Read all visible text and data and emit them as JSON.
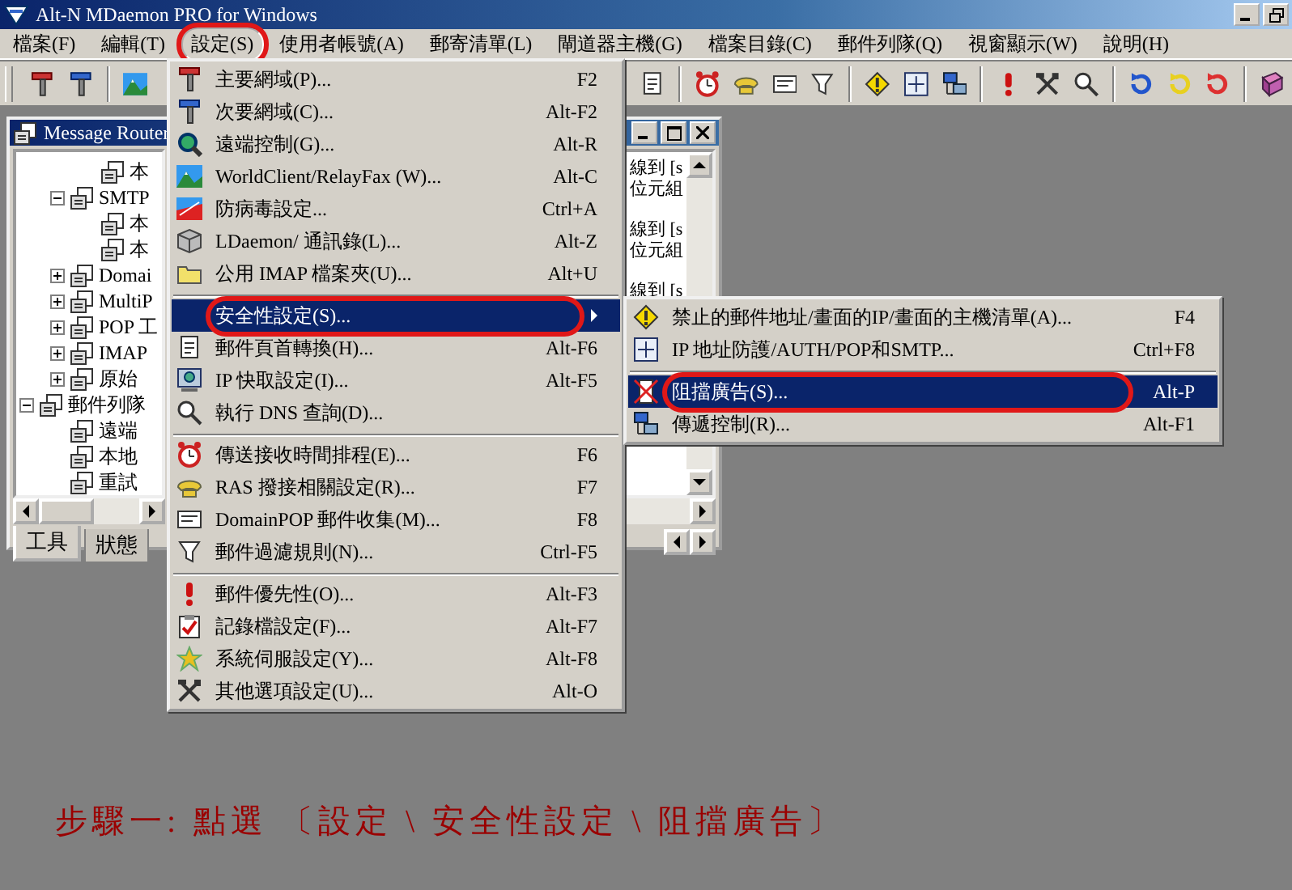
{
  "window": {
    "title": "Alt-N MDaemon PRO for Windows"
  },
  "menubar": {
    "items": [
      {
        "label": "檔案(F)",
        "selected": false,
        "circled": false
      },
      {
        "label": "編輯(T)",
        "selected": false,
        "circled": false
      },
      {
        "label": "設定(S)",
        "selected": true,
        "circled": true
      },
      {
        "label": "使用者帳號(A)",
        "selected": false,
        "circled": false
      },
      {
        "label": "郵寄清單(L)",
        "selected": false,
        "circled": false
      },
      {
        "label": "閘道器主機(G)",
        "selected": false,
        "circled": false
      },
      {
        "label": "檔案目錄(C)",
        "selected": false,
        "circled": false
      },
      {
        "label": "郵件列隊(Q)",
        "selected": false,
        "circled": false
      },
      {
        "label": "視窗顯示(W)",
        "selected": false,
        "circled": false
      },
      {
        "label": "說明(H)",
        "selected": false,
        "circled": false
      }
    ]
  },
  "child_window": {
    "title": "Message Router",
    "tree": [
      {
        "children": [
          {
            "children": [
              {
                "label": "本"
              }
            ]
          },
          {
            "label": "SMTP",
            "expanded": true,
            "children": [
              {
                "label": "本"
              },
              {
                "label": "本"
              }
            ]
          },
          {
            "label": "Domai",
            "expanded": false
          },
          {
            "label": "MultiP",
            "expanded": false
          },
          {
            "label": "POP 工",
            "expanded": false
          },
          {
            "label": "IMAP",
            "expanded": false
          },
          {
            "label": "原始",
            "expanded": false
          }
        ]
      },
      {
        "label": "郵件列隊",
        "expanded": true,
        "children": [
          {
            "label": "遠端"
          },
          {
            "label": "本地"
          },
          {
            "label": "重試"
          }
        ]
      }
    ],
    "log_entries": [
      {
        "text": "線到 [s",
        "detail": "位元組"
      },
      {
        "text": "線到 [s",
        "detail": "位元組"
      },
      {
        "text": "線到 [s"
      }
    ],
    "tabs": [
      {
        "label": "工具",
        "selected": true
      },
      {
        "label": "狀態",
        "selected": false
      }
    ]
  },
  "settings_menu": {
    "groups": [
      {
        "items": [
          {
            "label": "主要網域(P)...",
            "shortcut": "F2",
            "selected": false,
            "circled": false,
            "submenu": false
          },
          {
            "label": "次要網域(C)...",
            "shortcut": "Alt-F2",
            "selected": false,
            "circled": false,
            "submenu": false
          },
          {
            "label": "遠端控制(G)...",
            "shortcut": "Alt-R",
            "selected": false,
            "circled": false,
            "submenu": false
          },
          {
            "label": "WorldClient/RelayFax (W)...",
            "shortcut": "Alt-C",
            "selected": false,
            "circled": false,
            "submenu": false
          },
          {
            "label": "防病毒設定...",
            "shortcut": "Ctrl+A",
            "selected": false,
            "circled": false,
            "submenu": false
          },
          {
            "label": "LDaemon/ 通訊錄(L)...",
            "shortcut": "Alt-Z",
            "selected": false,
            "circled": false,
            "submenu": false
          },
          {
            "label": "公用 IMAP 檔案夾(U)...",
            "shortcut": "Alt+U",
            "selected": false,
            "circled": false,
            "submenu": false
          }
        ]
      },
      {
        "items": [
          {
            "label": "安全性設定(S)...",
            "selected": true,
            "circled": true,
            "submenu": true
          },
          {
            "label": "郵件頁首轉換(H)...",
            "shortcut": "Alt-F6",
            "selected": false,
            "circled": false,
            "submenu": false
          },
          {
            "label": "IP 快取設定(I)...",
            "shortcut": "Alt-F5",
            "selected": false,
            "circled": false,
            "submenu": false
          },
          {
            "label": "執行 DNS 查詢(D)...",
            "selected": false,
            "circled": false,
            "submenu": false
          }
        ]
      },
      {
        "items": [
          {
            "label": "傳送接收時間排程(E)...",
            "shortcut": "F6",
            "selected": false,
            "circled": false,
            "submenu": false
          },
          {
            "label": "RAS 撥接相關設定(R)...",
            "shortcut": "F7",
            "selected": false,
            "circled": false,
            "submenu": false
          },
          {
            "label": "DomainPOP 郵件收集(M)...",
            "shortcut": "F8",
            "selected": false,
            "circled": false,
            "submenu": false
          },
          {
            "label": "郵件過濾規則(N)...",
            "shortcut": "Ctrl-F5",
            "selected": false,
            "circled": false,
            "submenu": false
          }
        ]
      },
      {
        "items": [
          {
            "label": "郵件優先性(O)...",
            "shortcut": "Alt-F3",
            "selected": false,
            "circled": false,
            "submenu": false
          },
          {
            "label": "記錄檔設定(F)...",
            "shortcut": "Alt-F7",
            "selected": false,
            "circled": false,
            "submenu": false
          },
          {
            "label": "系統伺服設定(Y)...",
            "shortcut": "Alt-F8",
            "selected": false,
            "circled": false,
            "submenu": false
          },
          {
            "label": "其他選項設定(U)...",
            "shortcut": "Alt-O",
            "selected": false,
            "circled": false,
            "submenu": false
          }
        ]
      }
    ]
  },
  "security_submenu": {
    "groups": [
      {
        "items": [
          {
            "label": "禁止的郵件地址/畫面的IP/畫面的主機清單(A)...",
            "shortcut": "F4",
            "selected": false,
            "circled": false,
            "submenu": false
          },
          {
            "label": "IP 地址防護/AUTH/POP和SMTP...",
            "shortcut": "Ctrl+F8",
            "selected": false,
            "circled": false,
            "submenu": false
          }
        ]
      },
      {
        "items": [
          {
            "label": "阻擋廣告(S)...",
            "shortcut": "Alt-P",
            "selected": true,
            "circled": true,
            "submenu": false
          },
          {
            "label": "傳遞控制(R)...",
            "shortcut": "Alt-F1",
            "selected": false,
            "circled": false,
            "submenu": false
          }
        ]
      }
    ]
  },
  "caption": "步驟一: 點選 〔設定 \\ 安全性設定 \\ 阻擋廣告〕"
}
